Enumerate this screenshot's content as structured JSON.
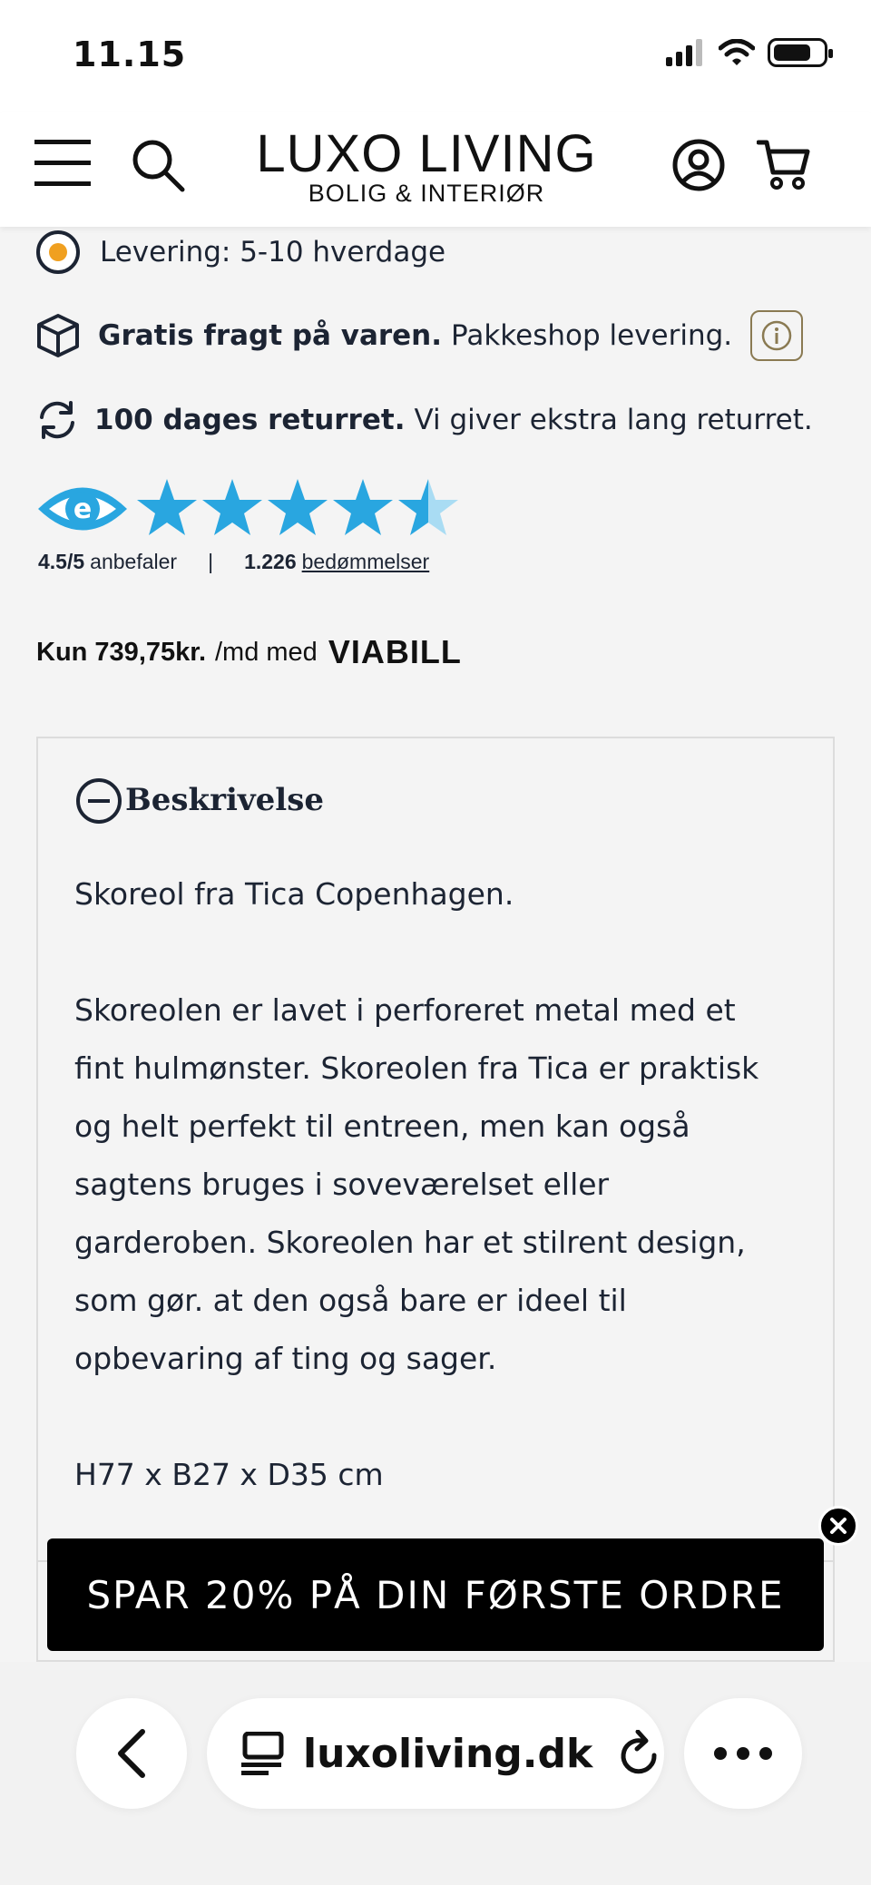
{
  "status": {
    "time": "11.15"
  },
  "header": {
    "logo_main": "LUXO LIVING",
    "logo_sub": "BOLIG & INTERIØR",
    "icons": [
      "menu-icon",
      "search-icon",
      "account-icon",
      "cart-icon"
    ]
  },
  "info": {
    "delivery": "Levering: 5-10 hverdage",
    "shipping_bold": "Gratis fragt på varen.",
    "shipping_rest": "Pakkeshop levering.",
    "return_bold": "100 dages returret.",
    "return_rest": "Vi giver ekstra lang returret."
  },
  "rating": {
    "score": "4.5/5",
    "score_label": "anbefaler",
    "separator": "|",
    "count": "1.226",
    "count_label": "bedømmelser",
    "stars_value": 4.5,
    "stars_max": 5
  },
  "financing": {
    "amount": "Kun 739,75kr.",
    "rest": "/md med",
    "brand": "VIABILL"
  },
  "description": {
    "title": "Beskrivelse",
    "intro": "Skoreol fra Tica Copenhagen.",
    "lines": [
      "Skoreolen er lavet i perforeret metal med et",
      "fint hulmønster. Skoreolen fra Tica er praktisk",
      "og helt perfekt til entreen, men kan også",
      "sagtens bruges i soveværelset eller",
      "garderoben. Skoreolen har et stilrent design,",
      "som gør. at den også bare er ideel til",
      "opbevaring af ting og sager."
    ],
    "dimensions": "H77 x B27 x D35 cm"
  },
  "promo": {
    "text": "SPAR 20% PÅ DIN FØRSTE ORDRE"
  },
  "browser": {
    "url": "luxoliving.dk"
  },
  "colors": {
    "star": "#29a6e0",
    "delivery_dot": "#f0a020",
    "info_border": "#8a7a52",
    "promo_bg": "#000000"
  }
}
